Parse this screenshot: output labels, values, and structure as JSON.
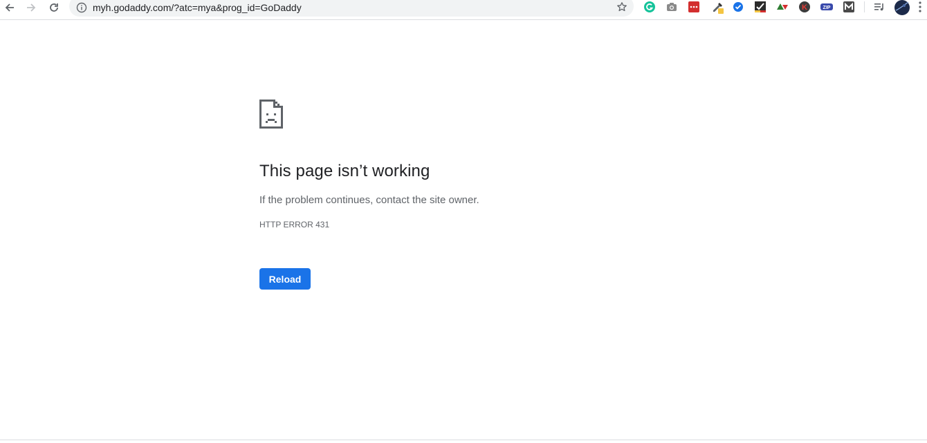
{
  "toolbar": {
    "back_icon": "arrow-left-icon",
    "forward_icon": "arrow-right-icon",
    "reload_icon": "reload-icon",
    "url": "myh.godaddy.com/?atc=mya&prog_id=GoDaddy",
    "site_info_icon": "info-icon",
    "bookmark_icon": "star-icon",
    "extensions": [
      {
        "name": "grammarly-icon",
        "color": "#15c39a"
      },
      {
        "name": "camera-icon",
        "color": "#757575"
      },
      {
        "name": "password-manager-icon",
        "color": "#d32f2f"
      },
      {
        "name": "color-picker-icon",
        "color": "#f4c542"
      },
      {
        "name": "checkmark-badge-icon",
        "color": "#1a73e8"
      },
      {
        "name": "task-checkbox-icon",
        "color": "#333333"
      },
      {
        "name": "triangle-arrows-icon",
        "color": "#2e7d32"
      },
      {
        "name": "k-circle-icon",
        "color": "#3c3c3c"
      },
      {
        "name": "zip-icon",
        "color": "#3949ab"
      },
      {
        "name": "gmail-m-icon",
        "color": "#5f6368"
      },
      {
        "name": "reading-list-icon",
        "color": "#5f6368"
      },
      {
        "name": "profile-avatar-icon",
        "color": "#1c2a4a"
      },
      {
        "name": "more-menu-icon",
        "color": "#5f6368"
      }
    ]
  },
  "error": {
    "icon": "sad-page-icon",
    "title": "This page isn’t working",
    "message": "If the problem continues, contact the site owner.",
    "code": "HTTP ERROR 431",
    "reload_label": "Reload",
    "accent_color": "#1a73e8"
  }
}
